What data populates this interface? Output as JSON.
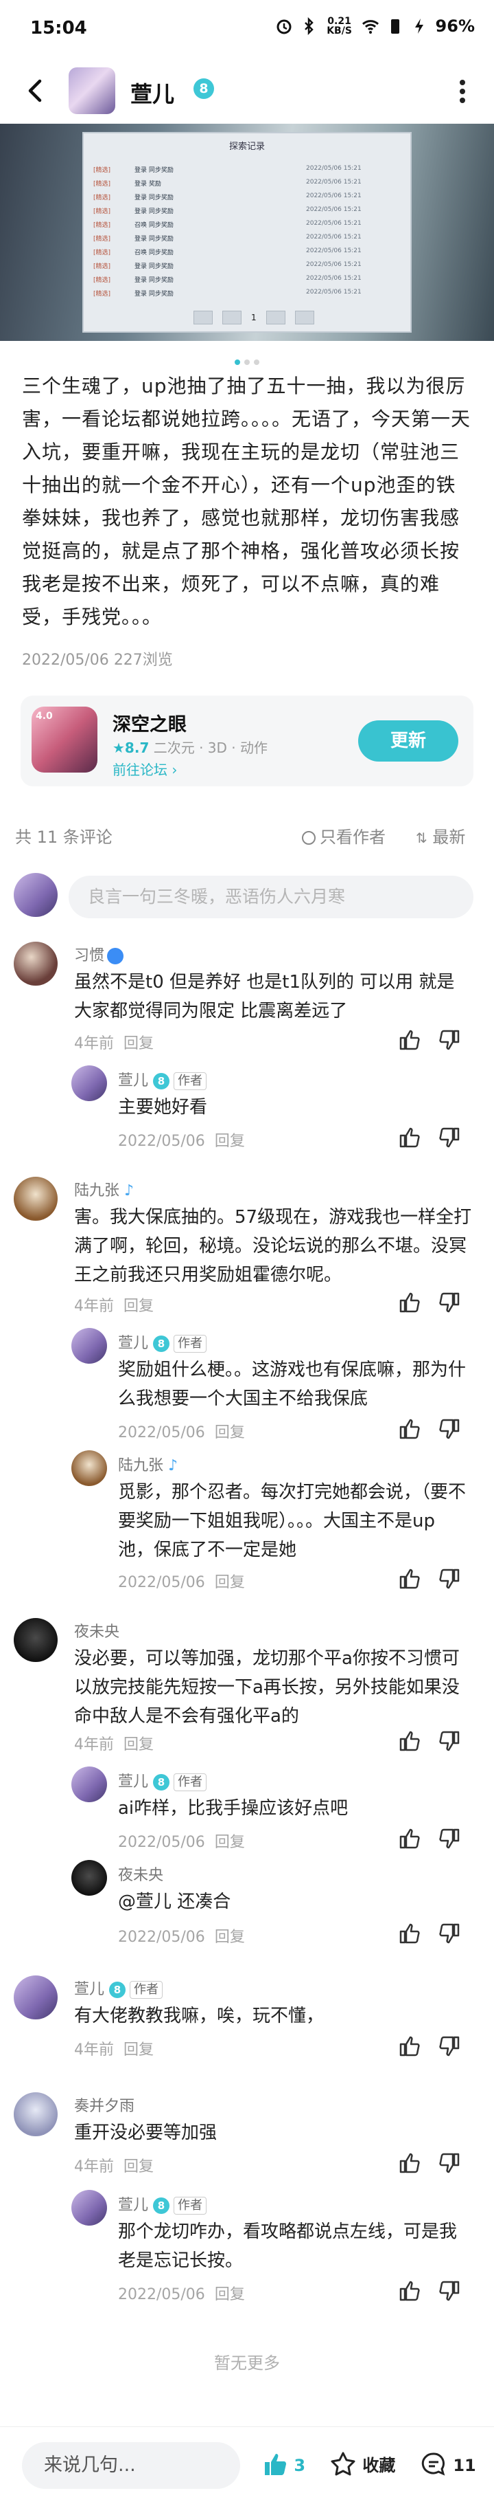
{
  "status_bar": {
    "time": "15:04",
    "battery": "96%",
    "net_speed": "0.21 KB/S"
  },
  "header": {
    "author_name": "萱儿",
    "author_level": "8"
  },
  "screenshot_panel": {
    "title": "探索记录",
    "rows": [
      [
        "[精选]",
        "登录 同步奖励",
        "2022/05/06 15:21"
      ],
      [
        "[精选]",
        "登录 奖励",
        "2022/05/06 15:21"
      ],
      [
        "[精选]",
        "登录 同步奖励",
        "2022/05/06 15:21"
      ],
      [
        "[精选]",
        "登录 同步奖励",
        "2022/05/06 15:21"
      ],
      [
        "[精选]",
        "召唤 同步奖励",
        "2022/05/06 15:21"
      ],
      [
        "[精选]",
        "登录 同步奖励",
        "2022/05/06 15:21"
      ],
      [
        "[精选]",
        "召唤 同步奖励",
        "2022/05/06 15:21"
      ],
      [
        "[精选]",
        "登录 同步奖励",
        "2022/05/06 15:21"
      ],
      [
        "[精选]",
        "登录 同步奖励",
        "2022/05/06 15:21"
      ],
      [
        "[精选]",
        "登录 同步奖励",
        "2022/05/06 15:21"
      ]
    ],
    "page": "1"
  },
  "post": {
    "body": "三个生魂了，up池抽了抽了五十一抽，我以为很厉害，一看论坛都说她拉跨。。。。无语了，今天第一天入坑，要重开嘛，我现在主玩的是龙切（常驻池三十抽出的就一个金不开心），还有一个up池歪的铁拳妹妹，我也养了，感觉也就那样，龙切伤害我感觉挺高的，就是点了那个神格，强化普攻必须长按我老是按不出来，烦死了，可以不点嘛，真的难受，手残党。。。",
    "date": "2022/05/06",
    "views": "227浏览"
  },
  "game_card": {
    "name": "深空之眼",
    "rating": "★8.7",
    "tags": "二次元 · 3D · 动作",
    "link": "前往论坛 ›",
    "button": "更新",
    "icon_text": "4.0"
  },
  "comments_header": {
    "count": "共 11 条评论",
    "only_author": "只看作者",
    "sort": "最新"
  },
  "input_placeholder": "良言一句三冬暖，恶语伤人六月寒",
  "comments": [
    {
      "name": "习惯",
      "text": "虽然不是t0 但是养好 也是t1队列的 可以用 就是大家都觉得同为限定 比震离差远了",
      "time": "4年前",
      "reply": "回复"
    },
    {
      "name": "萱儿",
      "level": "8",
      "tag": "作者",
      "text": "主要她好看",
      "time": "2022/05/06",
      "reply": "回复"
    },
    {
      "name": "陆九张",
      "text": "害。我大保底抽的。57级现在，游戏我也一样全打满了啊，轮回，秘境。没论坛说的那么不堪。没冥王之前我还只用奖励姐霍德尔呢。",
      "time": "4年前",
      "reply": "回复"
    },
    {
      "name": "萱儿",
      "level": "8",
      "tag": "作者",
      "text": "奖励姐什么梗。。这游戏也有保底嘛，那为什么我想要一个大国主不给我保底",
      "time": "2022/05/06",
      "reply": "回复"
    },
    {
      "name": "陆九张",
      "text": "觅影，那个忍者。每次打完她都会说，（要不要奖励一下姐姐我呢）。。。大国主不是up池，保底了不一定是她",
      "time": "2022/05/06",
      "reply": "回复"
    },
    {
      "name": "夜未央",
      "text": "没必要，可以等加强，龙切那个平a你按不习惯可以放完技能先短按一下a再长按，另外技能如果没命中敌人是不会有强化平a的",
      "time": "4年前",
      "reply": "回复"
    },
    {
      "name": "萱儿",
      "level": "8",
      "tag": "作者",
      "text": "ai咋样，比我手操应该好点吧",
      "time": "2022/05/06",
      "reply": "回复"
    },
    {
      "name": "夜未央",
      "text": "@萱儿  还凑合",
      "time": "2022/05/06",
      "reply": "回复"
    },
    {
      "name": "萱儿",
      "level": "8",
      "tag": "作者",
      "text": "有大佬教教我嘛，唉，玩不懂，",
      "time": "4年前",
      "reply": "回复"
    },
    {
      "name": "奏并夕雨",
      "text": "重开没必要等加强",
      "time": "4年前",
      "reply": "回复"
    },
    {
      "name": "萱儿",
      "level": "8",
      "tag": "作者",
      "text": "那个龙切咋办，看攻略都说点左线，可是我老是忘记长按。",
      "time": "2022/05/06",
      "reply": "回复"
    }
  ],
  "no_more": "暂无更多",
  "bottom_bar": {
    "input": "来说几句...",
    "likes": "3",
    "favorite": "收藏",
    "comments": "11"
  },
  "colors": {
    "accent": "#39c3d0",
    "level_badge": "#3ec7d6"
  }
}
